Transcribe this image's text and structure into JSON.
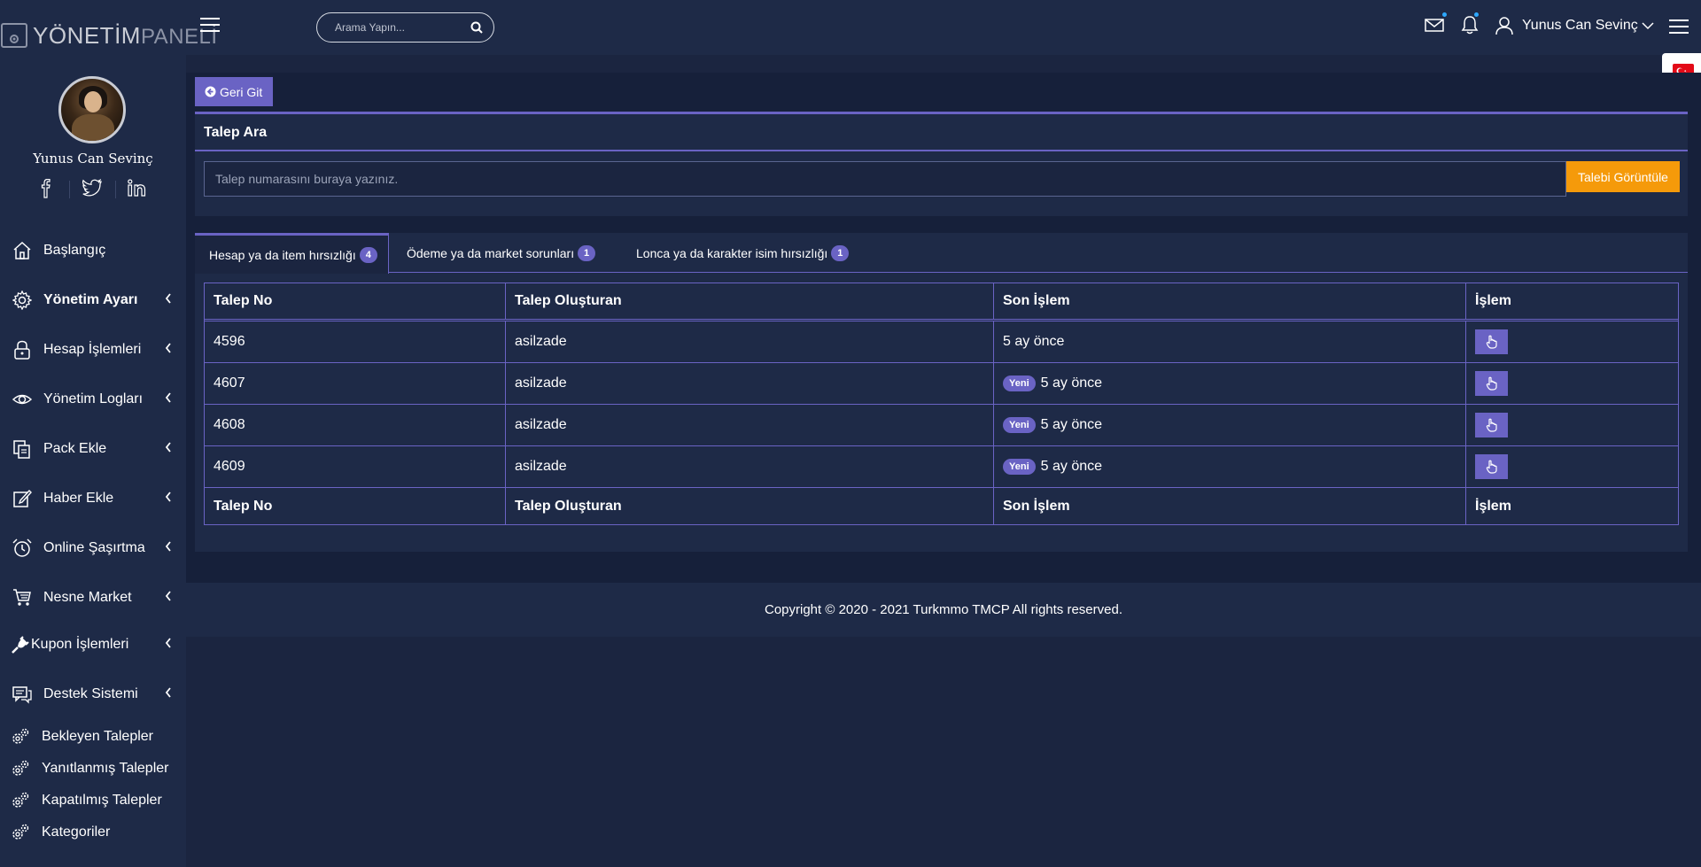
{
  "brand": {
    "part1": "YÖNETİM",
    "part2": "PANELİ"
  },
  "search": {
    "placeholder": "Arama Yapın..."
  },
  "user": {
    "name": "Yunus Can Sevinç"
  },
  "sidebar": {
    "profile_name": "Yunus Can Sevinç",
    "items": [
      {
        "label": "Başlangıç",
        "icon": "home-icon"
      },
      {
        "label": "Yönetim Ayarı",
        "icon": "gear-icon"
      },
      {
        "label": "Hesap İşlemleri",
        "icon": "lock-icon"
      },
      {
        "label": "Yönetim Logları",
        "icon": "eye-icon"
      },
      {
        "label": "Pack Ekle",
        "icon": "copy-icon"
      },
      {
        "label": "Haber Ekle",
        "icon": "edit-icon"
      },
      {
        "label": "Online Şaşırtma",
        "icon": "alarm-icon"
      },
      {
        "label": "Nesne Market",
        "icon": "cart-icon"
      },
      {
        "label": "Kupon İşlemleri",
        "icon": "plug-icon"
      },
      {
        "label": "Destek Sistemi",
        "icon": "chat-icon"
      }
    ],
    "sub_items": [
      {
        "label": "Bekleyen Talepler"
      },
      {
        "label": "Yanıtlanmış Talepler"
      },
      {
        "label": "Kapatılmış Talepler"
      },
      {
        "label": "Kategoriler"
      }
    ]
  },
  "back_button": {
    "label": "Geri Git"
  },
  "search_card": {
    "title": "Talep Ara",
    "input_placeholder": "Talep numarasını buraya yazınız.",
    "button_label": "Talebi Görüntüle"
  },
  "tabs": [
    {
      "label": "Hesap ya da item hırsızlığı",
      "count": "4"
    },
    {
      "label": "Ödeme ya da market sorunları",
      "count": "1"
    },
    {
      "label": "Lonca ya da karakter isim hırsızlığı",
      "count": "1"
    }
  ],
  "table": {
    "columns": [
      "Talep No",
      "Talep Oluşturan",
      "Son İşlem",
      "İşlem"
    ],
    "new_badge": "Yeni",
    "rows": [
      {
        "no": "4596",
        "creator": "asilzade",
        "last": "5 ay önce",
        "is_new": false
      },
      {
        "no": "4607",
        "creator": "asilzade",
        "last": "5 ay önce",
        "is_new": true
      },
      {
        "no": "4608",
        "creator": "asilzade",
        "last": "5 ay önce",
        "is_new": true
      },
      {
        "no": "4609",
        "creator": "asilzade",
        "last": "5 ay önce",
        "is_new": true
      }
    ]
  },
  "footer": {
    "text": "Copyright © 2020 - 2021 Turkmmo TMCP All rights reserved."
  },
  "colors": {
    "accent": "#6a63c4",
    "warning": "#f59a0a",
    "background": "#1b2540",
    "panel": "#1e2a47"
  }
}
